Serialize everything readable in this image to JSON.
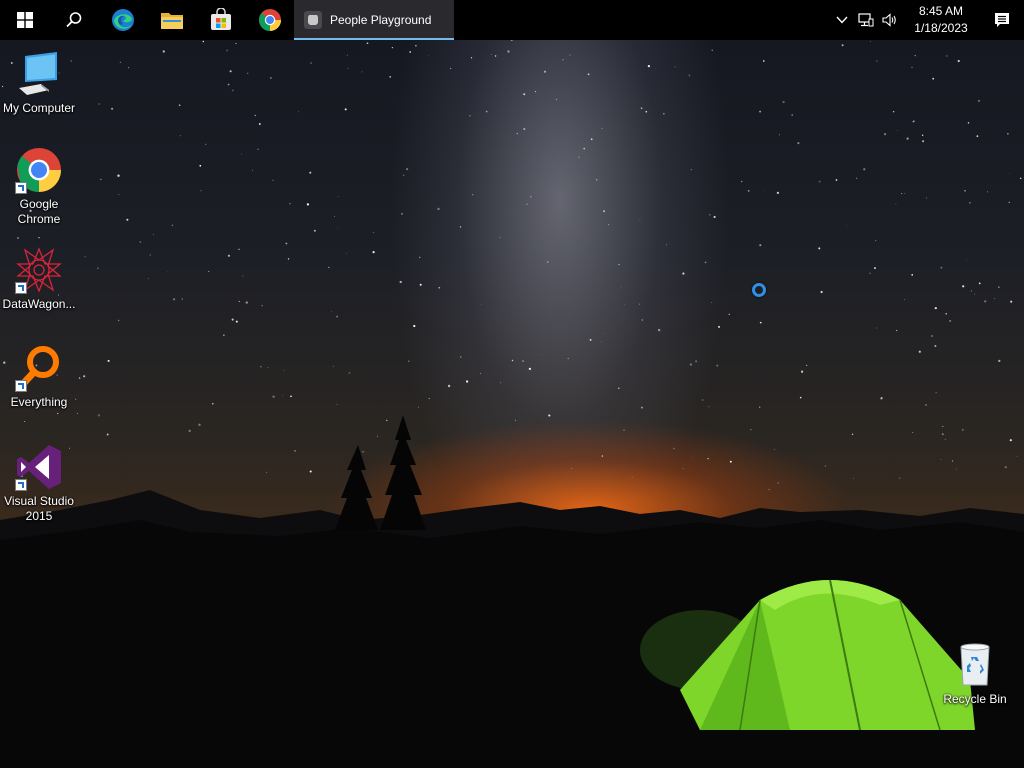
{
  "taskbar": {
    "start_icon": "windows-logo-icon",
    "pinned": [
      {
        "icon": "search-icon"
      },
      {
        "icon": "edge-icon"
      },
      {
        "icon": "file-explorer-icon"
      },
      {
        "icon": "microsoft-store-icon"
      },
      {
        "icon": "chrome-icon"
      }
    ],
    "running_app": {
      "label": "People Playground",
      "icon": "people-playground-icon"
    },
    "tray": {
      "icons": [
        "chevron-up-icon",
        "network-icon",
        "volume-icon"
      ],
      "time": "8:45 AM",
      "date": "1/18/2023",
      "notification_icon": "action-center-icon"
    }
  },
  "desktop": {
    "icons": [
      {
        "label": "My Computer",
        "icon": "computer-icon"
      },
      {
        "label": "Google Chrome",
        "icon": "chrome-icon"
      },
      {
        "label": "DataWagon...",
        "icon": "datawagon-icon"
      },
      {
        "label": "Everything",
        "icon": "everything-search-icon"
      },
      {
        "label": "Visual Studio 2015",
        "icon": "visual-studio-icon"
      },
      {
        "label": "Recycle Bin",
        "icon": "recycle-bin-icon"
      }
    ]
  },
  "colors": {
    "taskbar_bg": "#000000",
    "active_app_bg": "#2a2a2e",
    "active_indicator": "#76b9ed",
    "cursor_ring": "#2f8fe6",
    "tent_green": "#7fd62a",
    "horizon_orange": "#ff6e14"
  }
}
